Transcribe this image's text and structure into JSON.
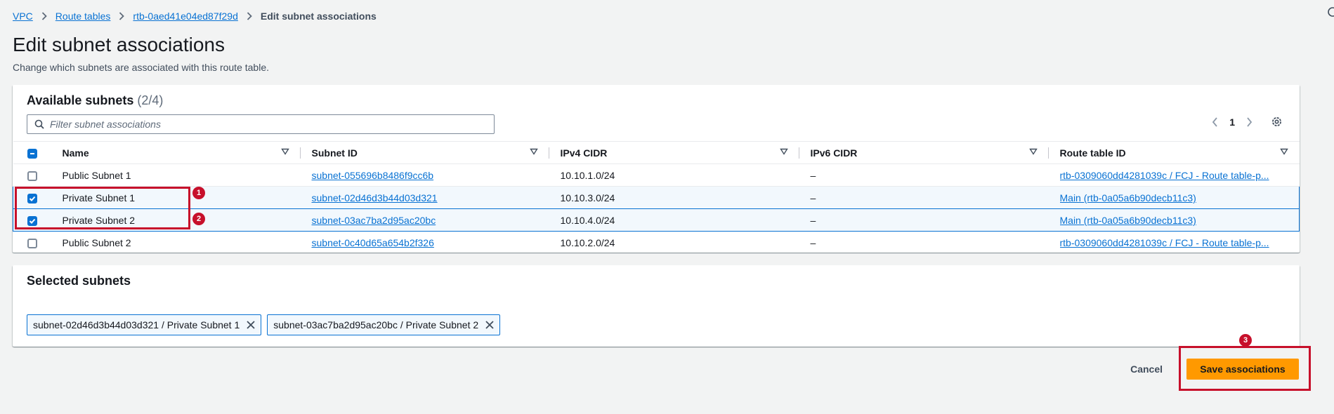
{
  "breadcrumb": {
    "items": [
      "VPC",
      "Route tables",
      "rtb-0aed41e04ed87f29d"
    ],
    "current": "Edit subnet associations"
  },
  "page": {
    "title": "Edit subnet associations",
    "description": "Change which subnets are associated with this route table."
  },
  "available": {
    "title": "Available subnets",
    "count": "(2/4)",
    "filter_placeholder": "Filter subnet associations",
    "page_number": "1",
    "columns": [
      "Name",
      "Subnet ID",
      "IPv4 CIDR",
      "IPv6 CIDR",
      "Route table ID"
    ],
    "rows": [
      {
        "checked": false,
        "name": "Public Subnet 1",
        "subnet_id": "subnet-055696b8486f9cc6b",
        "ipv4": "10.10.1.0/24",
        "ipv6": "–",
        "route_table": "rtb-0309060dd4281039c / FCJ - Route table-p..."
      },
      {
        "checked": true,
        "name": "Private Subnet 1",
        "subnet_id": "subnet-02d46d3b44d03d321",
        "ipv4": "10.10.3.0/24",
        "ipv6": "–",
        "route_table": "Main (rtb-0a05a6b90decb11c3)"
      },
      {
        "checked": true,
        "name": "Private Subnet 2",
        "subnet_id": "subnet-03ac7ba2d95ac20bc",
        "ipv4": "10.10.4.0/24",
        "ipv6": "–",
        "route_table": "Main (rtb-0a05a6b90decb11c3)"
      },
      {
        "checked": false,
        "name": "Public Subnet 2",
        "subnet_id": "subnet-0c40d65a654b2f326",
        "ipv4": "10.10.2.0/24",
        "ipv6": "–",
        "route_table": "rtb-0309060dd4281039c / FCJ - Route table-p..."
      }
    ]
  },
  "selected": {
    "title": "Selected subnets",
    "tokens": [
      "subnet-02d46d3b44d03d321 / Private Subnet 1",
      "subnet-03ac7ba2d95ac20bc / Private Subnet 2"
    ]
  },
  "actions": {
    "cancel_label": "Cancel",
    "save_label": "Save associations"
  },
  "annotations": [
    "1",
    "2",
    "3"
  ],
  "colors": {
    "link": "#0972d3",
    "primary_button": "#ff9900",
    "annotation": "#c7102b",
    "selected_row": "#f2f8fd"
  }
}
